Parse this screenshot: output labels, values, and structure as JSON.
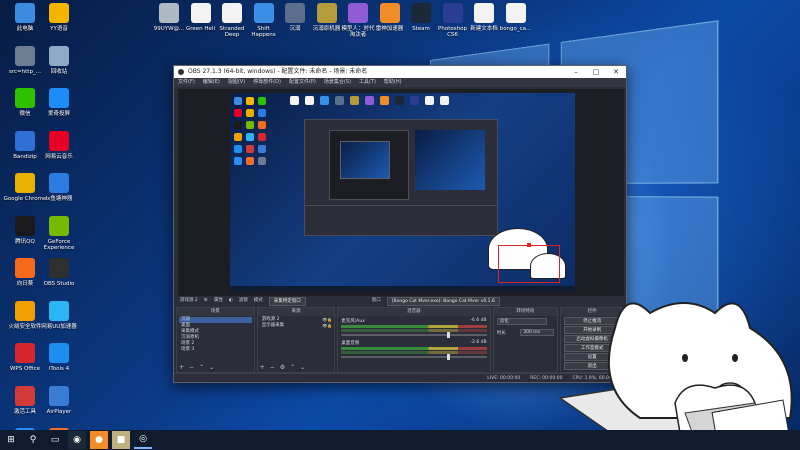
{
  "desktop": {
    "left_icons": [
      {
        "label": "此电脑",
        "icon": "computer-icon",
        "color": "#3b8be0"
      },
      {
        "label": "YY语音",
        "icon": "yy-icon",
        "color": "#f4b400"
      },
      {
        "label": "src=http_...",
        "icon": "image-file-icon",
        "color": "#6b7c93"
      },
      {
        "label": "回收站",
        "icon": "recycle-bin-icon",
        "color": "#8da9c4"
      },
      {
        "label": "微信",
        "icon": "wechat-icon",
        "color": "#2dc100"
      },
      {
        "label": "爱奇投屏",
        "icon": "cast-icon",
        "color": "#1d8cf8"
      },
      {
        "label": "Bandizip",
        "icon": "bandizip-icon",
        "color": "#2f6fd6"
      },
      {
        "label": "网易云音乐",
        "icon": "netease-music-icon",
        "color": "#e60026"
      },
      {
        "label": "Google Chrome",
        "icon": "chrome-icon",
        "color": "#e8b000"
      },
      {
        "label": "lx鱼塘神器",
        "icon": "fish-app-icon",
        "color": "#2b7be0"
      },
      {
        "label": "腾讯QQ",
        "icon": "qq-icon",
        "color": "#1a1a1a"
      },
      {
        "label": "GeForce Experience",
        "icon": "geforce-icon",
        "color": "#76b900"
      },
      {
        "label": "向日葵",
        "icon": "sunflower-icon",
        "color": "#f46a1a"
      },
      {
        "label": "OBS Studio",
        "icon": "obs-icon",
        "color": "#2f2f2f"
      },
      {
        "label": "火绒安全软件",
        "icon": "huorong-icon",
        "color": "#f29f05"
      },
      {
        "label": "网易UU加速器",
        "icon": "uu-icon",
        "color": "#2bb5f5"
      },
      {
        "label": "WPS Office",
        "icon": "wps-icon",
        "color": "#d7262d"
      },
      {
        "label": "iTools 4",
        "icon": "itools-icon",
        "color": "#1c8ef0"
      },
      {
        "label": "激活工具",
        "icon": "activation-tool-icon",
        "color": "#d23a3a"
      },
      {
        "label": "AirPlayer",
        "icon": "airplayer-icon",
        "color": "#3a7bd5"
      },
      {
        "label": "百度网盘",
        "icon": "baidu-netdisk-icon",
        "color": "#2d8cf0"
      },
      {
        "label": "Origin",
        "icon": "origin-icon",
        "color": "#f56c2d"
      }
    ],
    "top_icons": [
      {
        "label": "99UYW@...",
        "icon": "file-icon",
        "color": "#b0b8c4"
      },
      {
        "label": "Green Hell",
        "icon": "document-icon",
        "color": "#f3f3f3"
      },
      {
        "label": "Stranded Deep",
        "icon": "document-icon",
        "color": "#f3f3f3"
      },
      {
        "label": "Shift Happens",
        "icon": "game-icon",
        "color": "#3a8ee6"
      },
      {
        "label": "沉溺",
        "icon": "game-icon",
        "color": "#5b6e8c"
      },
      {
        "label": "沉溺原机器",
        "icon": "game-icon",
        "color": "#b59b3a"
      },
      {
        "label": "模型人：时代淘汰者",
        "icon": "game-icon",
        "color": "#8f5bd6"
      },
      {
        "label": "雷神加速器",
        "icon": "thunder-accelerator-icon",
        "color": "#f28c28"
      },
      {
        "label": "Steam",
        "icon": "steam-icon",
        "color": "#1b2838"
      },
      {
        "label": "Photoshop CS6",
        "icon": "photoshop-icon",
        "color": "#2a3d91"
      },
      {
        "label": "新建文本档",
        "icon": "text-file-icon",
        "color": "#f3f3f3"
      },
      {
        "label": "bongo_ca...",
        "icon": "text-file-icon",
        "color": "#f3f3f3"
      }
    ]
  },
  "obs": {
    "title": "OBS 27.1.3 (64-bit, windows) - 配置文件: 未命名 - 场景: 未命名",
    "menu": [
      "文件(F)",
      "编辑(E)",
      "视图(V)",
      "停靠部件(D)",
      "配置文件(P)",
      "场景集合(S)",
      "工具(T)",
      "帮助(H)"
    ],
    "midbar": {
      "source_name": "游戏源 2",
      "properties": "属性",
      "filters": "滤镜",
      "mode_label": "模式",
      "mode_value": "采集特定窗口",
      "window_label": "窗口",
      "window_value": "[Bongo Cat Mver.exe]: Bongo Cat Mver v0.1.6"
    },
    "scenes": {
      "header": "场景",
      "items": [
        "沉溺",
        "桌面",
        "采集模式",
        "沉溺原机",
        "场景 2",
        "场景 3"
      ]
    },
    "sources": {
      "header": "来源",
      "items": [
        "游戏源 2",
        "显示器采集"
      ]
    },
    "mixer": {
      "header": "混音器",
      "channels": [
        {
          "name": "麦克风/Aux",
          "db": "-6.6 dB"
        },
        {
          "name": "桌面音频",
          "db": "-2.6 dB"
        }
      ]
    },
    "transitions": {
      "header": "转场特效",
      "type": "淡化",
      "duration_label": "时长",
      "duration": "300 ms"
    },
    "controls": {
      "header": "控件",
      "buttons": [
        "停止推流",
        "开始录制",
        "启动虚拟摄像机",
        "工作室模式",
        "设置",
        "退出"
      ]
    },
    "status": {
      "live": "LIVE: 00:00:00",
      "rec": "REC: 00:00:00",
      "cpu": "CPU: 1.9%, 60.00 fps"
    }
  }
}
